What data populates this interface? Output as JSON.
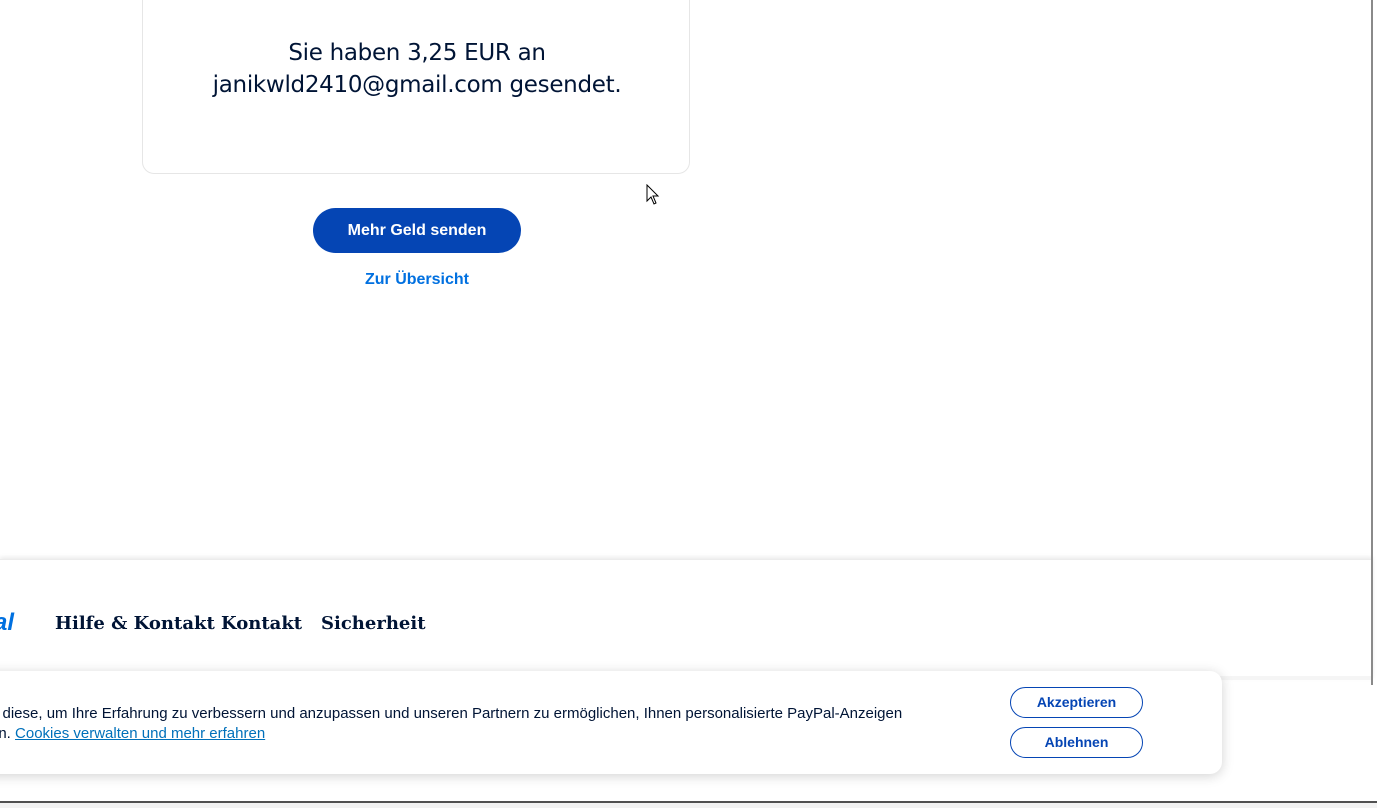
{
  "confirmation": {
    "line1": "Sie haben 3,25 EUR an",
    "line2": "janikwld2410@gmail.com gesendet."
  },
  "actions": {
    "send_more_label": "Mehr Geld senden",
    "overview_label": "Zur Übersicht"
  },
  "footer": {
    "logo_fragment": "al",
    "links": [
      "Hilfe & Kontakt",
      "Kontakt",
      "Sicherheit"
    ]
  },
  "cookie_banner": {
    "text_line1": "ir diese, um Ihre Erfahrung zu verbessern und anzupassen und unseren Partnern zu ermöglichen, Ihnen personalisierte PayPal-Anzeigen",
    "text_line2_prefix": "en. ",
    "link_label": "Cookies verwalten und mehr erfahren",
    "accept_label": "Akzeptieren",
    "decline_label": "Ablehnen"
  },
  "colors": {
    "primary_button": "#0545b4",
    "link": "#0070e0",
    "text_dark": "#001435"
  }
}
